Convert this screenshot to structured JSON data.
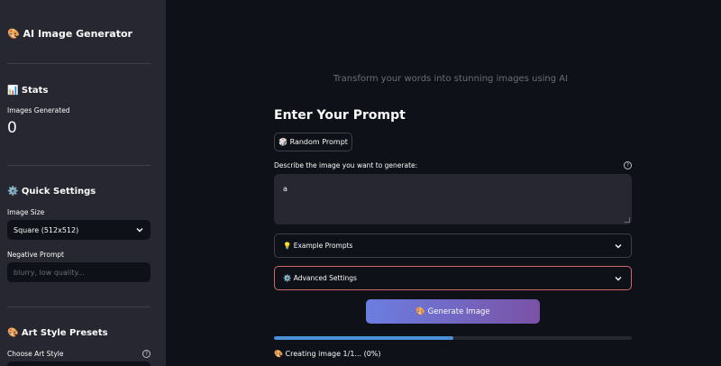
{
  "sidebar": {
    "title": "🎨 AI Image Generator",
    "stats_heading": "📊 Stats",
    "images_generated_label": "Images Generated",
    "images_generated_value": "0",
    "quick_settings_heading": "⚙️ Quick Settings",
    "image_size_label": "Image Size",
    "image_size_value": "Square (512x512)",
    "negative_prompt_label": "Negative Prompt",
    "negative_prompt_placeholder": "blurry, low quality...",
    "art_style_heading": "🎨 Art Style Presets",
    "choose_art_style_label": "Choose Art Style"
  },
  "main": {
    "subtitle": "Transform your words into stunning images using AI",
    "heading": "Enter Your Prompt",
    "random_prompt_button": "🎲 Random Prompt",
    "prompt_label": "Describe the image you want to generate:",
    "prompt_value": "a",
    "example_prompts_label": "💡 Example Prompts",
    "advanced_settings_label": "⚙️ Advanced Settings",
    "generate_button": "🎨 Generate Image",
    "progress_percent": 50,
    "status_text": "🎨 Creating image 1/1... (0%)"
  },
  "icons": {
    "help": "help-circle-icon",
    "chevron": "chevron-down-icon"
  },
  "colors": {
    "accent_gradient_start": "#6b7ee0",
    "accent_gradient_end": "#7a52a6",
    "progress": "#4a90d9",
    "focus_border": "#d06a6a"
  }
}
